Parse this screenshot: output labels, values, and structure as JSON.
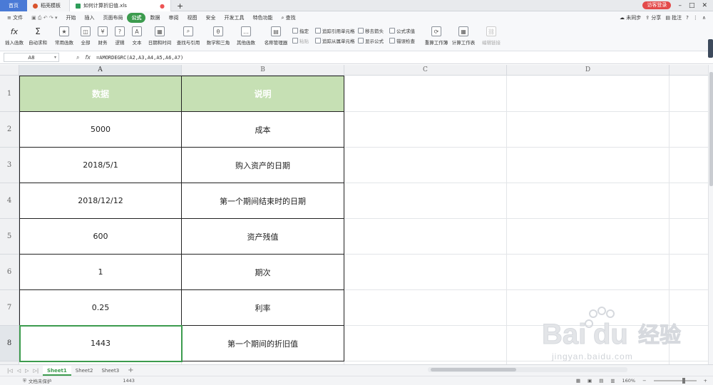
{
  "titlebar": {
    "home_tab": "首页",
    "template_tab": "稻壳模板",
    "file_tab": "如何计算折旧值.xls",
    "guest_button": "访客登录"
  },
  "menubar": {
    "file_menu": "文件",
    "items": [
      "开始",
      "插入",
      "页面布局",
      "公式",
      "数据",
      "审阅",
      "视图",
      "安全",
      "开发工具",
      "特色功能"
    ],
    "search_label": "查找",
    "sync_label": "未同步",
    "share_label": "分享",
    "batch_label": "批注"
  },
  "ribbon": {
    "insert_function": "插入函数",
    "autosum": "自动求和",
    "common_functions": "常用函数",
    "all": "全部",
    "finance": "财务",
    "logic": "逻辑",
    "text": "文本",
    "datetime": "日期和时间",
    "lookup": "查找与引用",
    "math": "数学和三角",
    "other": "其他函数",
    "name_manager": "名称管理器",
    "specify": "指定",
    "paste": "粘贴",
    "trace_precedents": "追踪引用单元格",
    "trace_dependents": "追踪从属单元格",
    "remove_arrows": "移去箭头",
    "show_formulas": "显示公式",
    "formula_evaluate": "公式求值",
    "error_check": "错误检查",
    "recalc_workbook": "重算工作簿",
    "calc_sheet": "计算工作表",
    "edit_link": "编辑链接"
  },
  "formulabar": {
    "cell_ref": "A8",
    "formula": "=AMORDEGRC(A2,A3,A4,A5,A6,A7)"
  },
  "columns": [
    "A",
    "B",
    "C",
    "D"
  ],
  "rows": [
    {
      "num": "1",
      "a": "数据",
      "b": "说明"
    },
    {
      "num": "2",
      "a": "5000",
      "b": "成本"
    },
    {
      "num": "3",
      "a": "2018/5/1",
      "b": "购入资产的日期"
    },
    {
      "num": "4",
      "a": "2018/12/12",
      "b": "第一个期间结束时的日期"
    },
    {
      "num": "5",
      "a": "600",
      "b": "资产残值"
    },
    {
      "num": "6",
      "a": "1",
      "b": "期次"
    },
    {
      "num": "7",
      "a": "0.25",
      "b": "利率"
    },
    {
      "num": "8",
      "a": "1443",
      "b": "第一个期间的折旧值"
    }
  ],
  "sheets": [
    "Sheet1",
    "Sheet2",
    "Sheet3"
  ],
  "status": {
    "protection": "文档未保护",
    "value": "1443",
    "zoom": "160%"
  },
  "colors": {
    "accent": "#3c9b4e",
    "header_fill": "#c6e0b4",
    "home_tab": "#4a7ad6",
    "guest": "#e34a4a"
  }
}
